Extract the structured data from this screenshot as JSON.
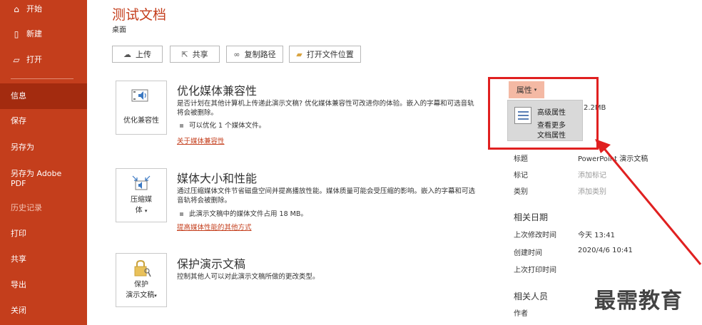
{
  "sidebar": {
    "items": [
      {
        "label": "开始",
        "icon": "home-icon"
      },
      {
        "label": "新建",
        "icon": "new-document-icon"
      },
      {
        "label": "打开",
        "icon": "open-folder-icon"
      },
      {
        "label": "信息"
      },
      {
        "label": "保存"
      },
      {
        "label": "另存为"
      },
      {
        "label": "另存为 Adobe PDF"
      },
      {
        "label": "历史记录"
      },
      {
        "label": "打印"
      },
      {
        "label": "共享"
      },
      {
        "label": "导出"
      },
      {
        "label": "关闭"
      }
    ],
    "accent": "#c43e1c",
    "active_bg": "#a32b0f"
  },
  "header": {
    "title": "测试文档",
    "location": "桌面"
  },
  "toolbar": {
    "upload": "上传",
    "share": "共享",
    "copy_path": "复制路径",
    "open_location": "打开文件位置"
  },
  "sections": {
    "media_compat": {
      "card_label": "优化兼容性",
      "title": "优化媒体兼容性",
      "text": "是否计划在其他计算机上传递此演示文稿? 优化媒体兼容性可改进你的体验。嵌入的字幕和可选音轨将会被删除。",
      "bullet": "可以优化 1 个媒体文件。",
      "link": "关于媒体兼容性"
    },
    "media_size": {
      "card_label_1": "压缩媒",
      "card_label_2": "体",
      "title": "媒体大小和性能",
      "text": "通过压缩媒体文件节省磁盘空间并提高播放性能。媒体质量可能会受压缩的影响。嵌入的字幕和可选音轨将会被删除。",
      "bullet": "此演示文稿中的媒体文件占用 18 MB。",
      "link": "提高媒体性能的其他方式"
    },
    "protect": {
      "card_label_1": "保护",
      "card_label_2": "演示文稿",
      "title": "保护演示文稿",
      "text": "控制其他人可以对此演示文稿所做的更改类型。"
    }
  },
  "properties": {
    "button": "属性",
    "dropdown": {
      "advanced": "高级属性",
      "view_more_1": "查看更多",
      "view_more_2": "文档属性"
    },
    "size_partial": "2.2MB",
    "rows": [
      {
        "key": "标题",
        "value": "PowerPoint 演示文稿"
      },
      {
        "key": "标记",
        "value": "添加标记"
      },
      {
        "key": "类别",
        "value": "添加类别"
      }
    ],
    "dates_header": "相关日期",
    "dates": [
      {
        "key": "上次修改时间",
        "value": "今天 13:41"
      },
      {
        "key": "创建时间",
        "value": "2020/4/6 10:41"
      },
      {
        "key": "上次打印时间",
        "value": ""
      }
    ],
    "people_header": "相关人员",
    "author_key": "作者"
  },
  "watermark": "最需教育",
  "annotation_color": "#e02020"
}
